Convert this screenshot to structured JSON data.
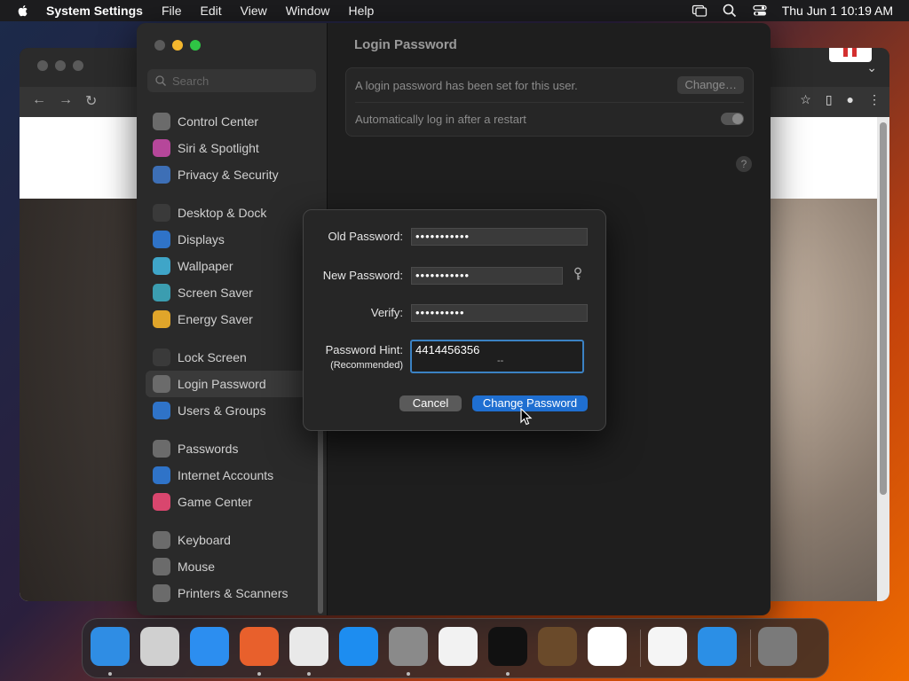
{
  "menubar": {
    "app": "System Settings",
    "items": [
      "File",
      "Edit",
      "View",
      "Window",
      "Help"
    ],
    "clock": "Thu Jun 1  10:19 AM",
    "status_icons": [
      "screen-mirroring-icon",
      "search-icon",
      "control-center-icon"
    ]
  },
  "background_window": {
    "app": "Google Chrome",
    "nav_icons": [
      "back-icon",
      "forward-icon",
      "reload-icon"
    ],
    "toolbar_icons": [
      "bookmark-star-icon",
      "side-panel-icon",
      "profile-icon",
      "more-icon"
    ]
  },
  "settings": {
    "search_placeholder": "Search",
    "sidebar": [
      {
        "label": "Control Center",
        "icon": "control-center-icon",
        "color": "#6b6b6b"
      },
      {
        "label": "Siri & Spotlight",
        "icon": "siri-icon",
        "color": "#b6479a"
      },
      {
        "label": "Privacy & Security",
        "icon": "hand-icon",
        "color": "#3d6fb6"
      },
      {
        "label": "Desktop & Dock",
        "icon": "dock-icon",
        "color": "#3a3a3a",
        "gap_before": true
      },
      {
        "label": "Displays",
        "icon": "sun-icon",
        "color": "#2f73c8"
      },
      {
        "label": "Wallpaper",
        "icon": "wallpaper-icon",
        "color": "#3fa5c8"
      },
      {
        "label": "Screen Saver",
        "icon": "screen-saver-icon",
        "color": "#3b9db0"
      },
      {
        "label": "Energy Saver",
        "icon": "bulb-icon",
        "color": "#e0a52a"
      },
      {
        "label": "Lock Screen",
        "icon": "lock-icon",
        "color": "#3a3a3a",
        "gap_before": true
      },
      {
        "label": "Login Password",
        "icon": "key-icon",
        "color": "#6b6b6b",
        "selected": true
      },
      {
        "label": "Users & Groups",
        "icon": "users-icon",
        "color": "#2f73c8"
      },
      {
        "label": "Passwords",
        "icon": "key-icon",
        "color": "#6b6b6b",
        "gap_before": true
      },
      {
        "label": "Internet Accounts",
        "icon": "at-icon",
        "color": "#2f73c8"
      },
      {
        "label": "Game Center",
        "icon": "game-center-icon",
        "color": "#d9466e"
      },
      {
        "label": "Keyboard",
        "icon": "keyboard-icon",
        "color": "#6b6b6b",
        "gap_before": true
      },
      {
        "label": "Mouse",
        "icon": "mouse-icon",
        "color": "#6b6b6b"
      },
      {
        "label": "Printers & Scanners",
        "icon": "printer-icon",
        "color": "#6b6b6b"
      }
    ],
    "pane": {
      "title": "Login Password",
      "status_text": "A login password has been set for this user.",
      "change_button": "Change…",
      "auto_login_label": "Automatically log in after a restart",
      "auto_login_enabled": false,
      "help": "?"
    }
  },
  "dialog": {
    "old_label": "Old Password:",
    "old_value": "•••••••••••",
    "new_label": "New Password:",
    "new_value": "•••••••••••",
    "verify_label": "Verify:",
    "verify_value": "••••••••••",
    "hint_label": "Password Hint:",
    "hint_sub": "(Recommended)",
    "hint_value": "4414456356",
    "hint_mark": "--",
    "cancel": "Cancel",
    "change": "Change Password",
    "accent": "#1f6fd1"
  },
  "dock": [
    {
      "name": "finder",
      "color": "#2f8de4",
      "running": true
    },
    {
      "name": "launchpad",
      "color": "#d0d0d0",
      "running": false
    },
    {
      "name": "safari",
      "color": "#2c8ef0",
      "running": false
    },
    {
      "name": "firefox",
      "color": "#e8602c",
      "running": true
    },
    {
      "name": "chrome",
      "color": "#e9e9e9",
      "running": true
    },
    {
      "name": "app-store",
      "color": "#1d8df0",
      "running": false
    },
    {
      "name": "system-settings",
      "color": "#8a8a8a",
      "running": true
    },
    {
      "name": "textedit",
      "color": "#f2f2f2",
      "running": false
    },
    {
      "name": "terminal",
      "color": "#111111",
      "running": true
    },
    {
      "name": "garageband",
      "color": "#6a4a2a",
      "running": false
    },
    {
      "name": "vscode",
      "color": "#ffffff",
      "running": false
    },
    {
      "name": "visual-studio",
      "color": "#f5f5f5",
      "running": false,
      "sep_before": true
    },
    {
      "name": "keynote",
      "color": "#2b8fe6",
      "running": false
    },
    {
      "name": "trash",
      "color": "#7a7a7a",
      "running": false,
      "sep_before": true
    }
  ]
}
